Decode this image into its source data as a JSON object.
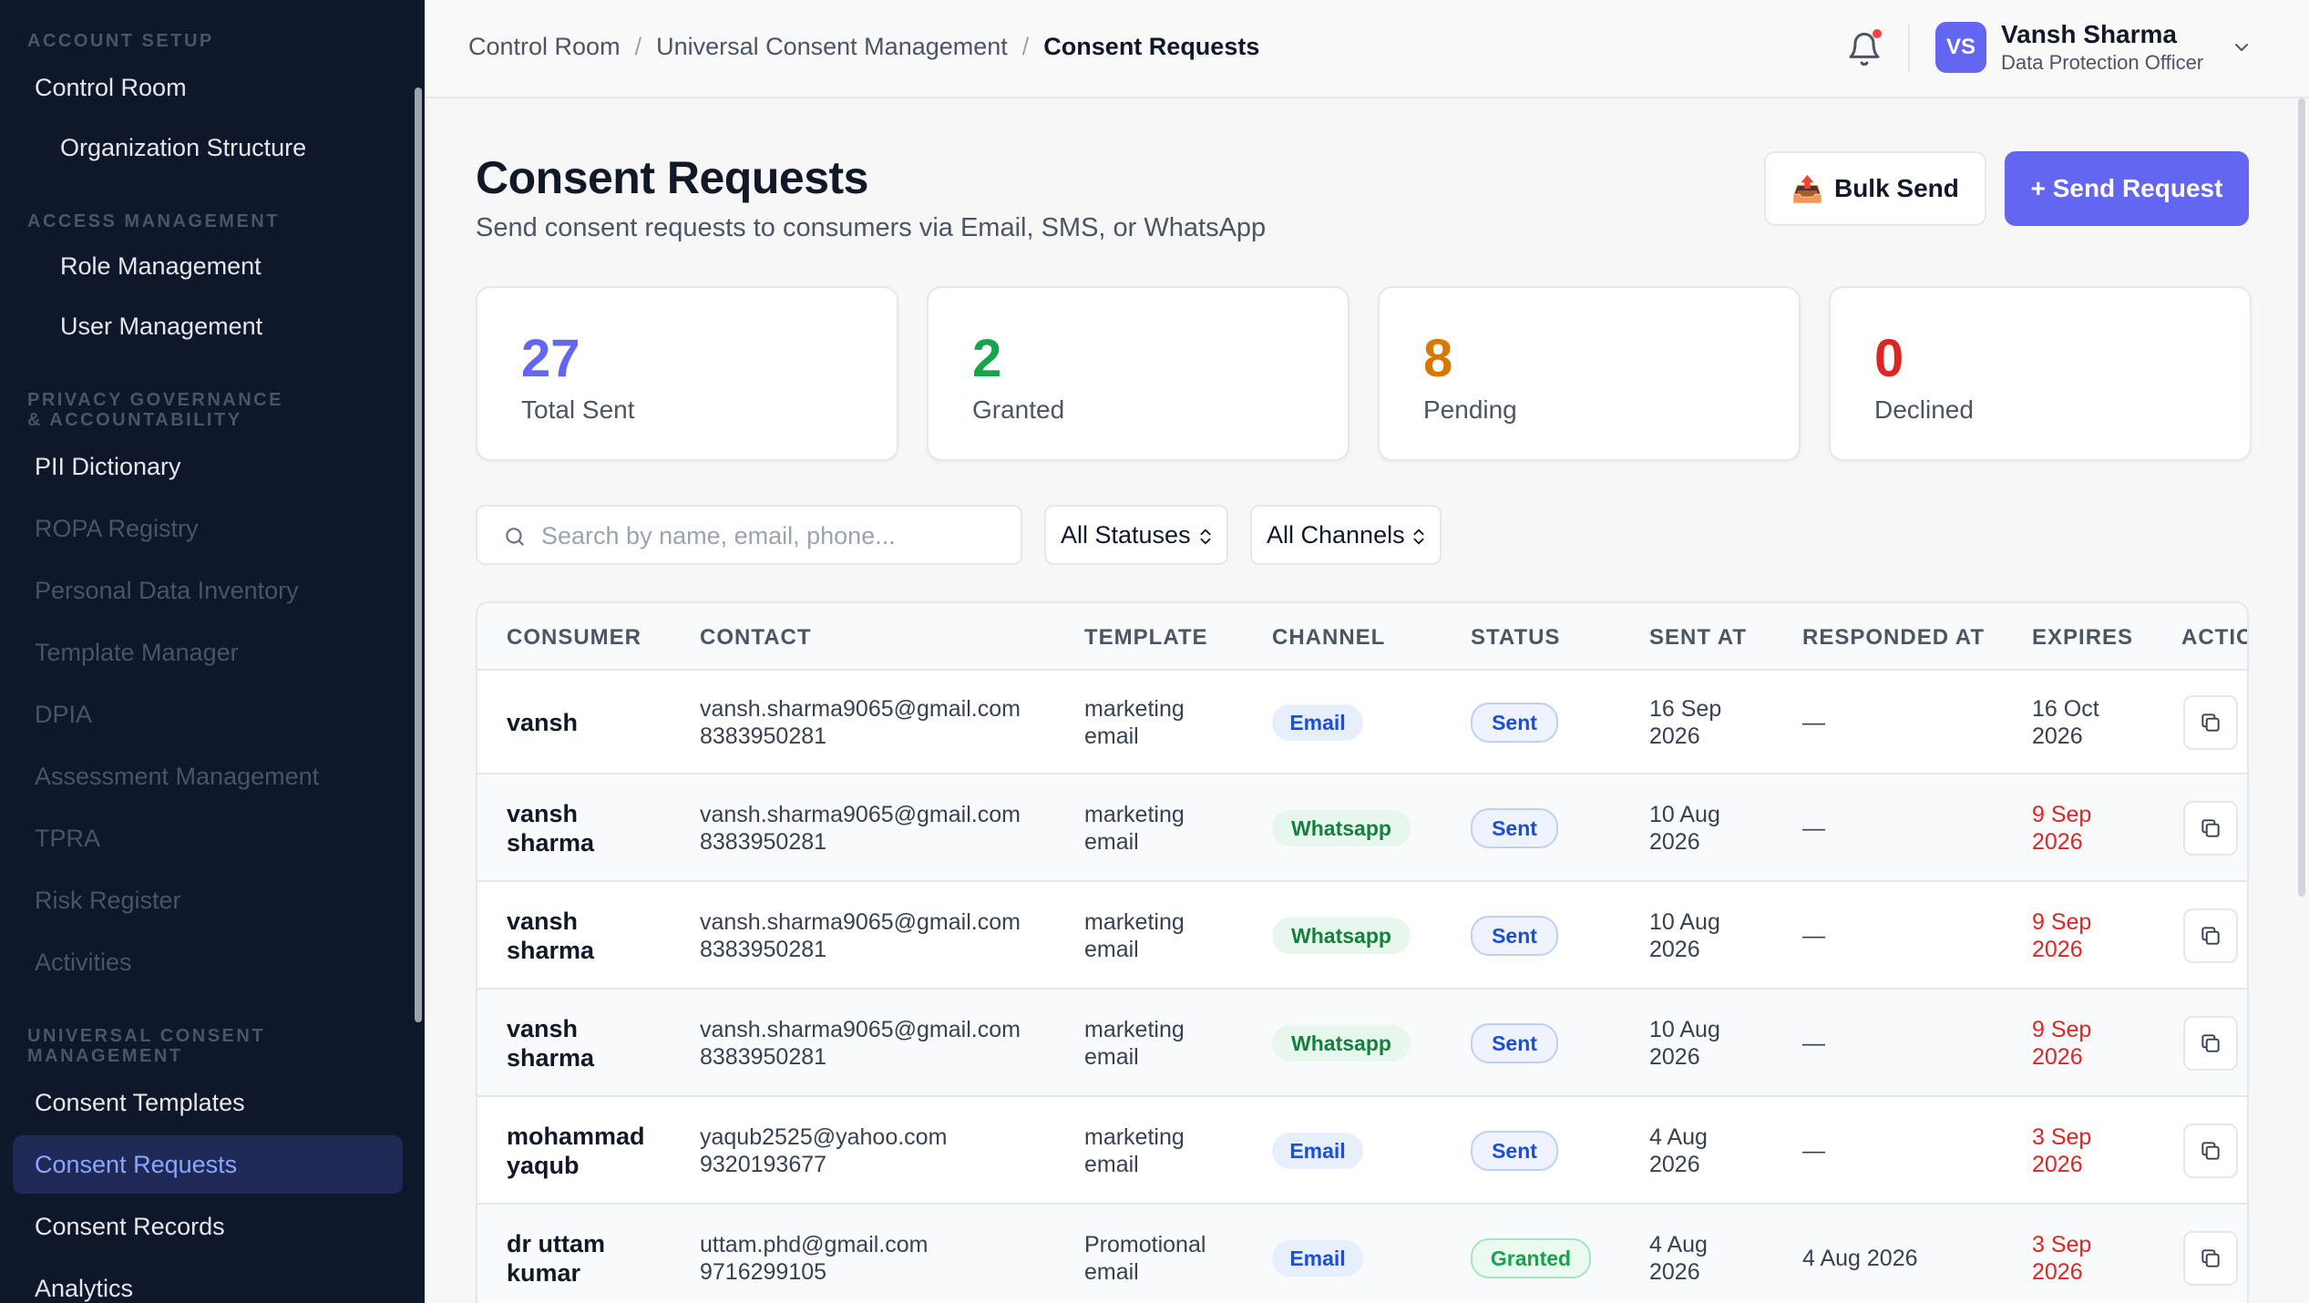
{
  "sidebar": {
    "sections": {
      "account_setup": "ACCOUNT SETUP",
      "access_management": "ACCESS MANAGEMENT",
      "privacy_governance": "PRIVACY GOVERNANCE & ACCOUNTABILITY",
      "universal_consent": "UNIVERSAL CONSENT MANAGEMENT"
    },
    "items": {
      "control_room": "Control Room",
      "organization_structure": "Organization Structure",
      "role_management": "Role Management",
      "user_management": "User Management",
      "pii_dictionary": "PII Dictionary",
      "ropa_registry": "ROPA Registry",
      "personal_data_inventory": "Personal Data Inventory",
      "template_manager": "Template Manager",
      "dpia": "DPIA",
      "assessment_management": "Assessment Management",
      "tpra": "TPRA",
      "risk_register": "Risk Register",
      "activities": "Activities",
      "consent_templates": "Consent Templates",
      "consent_requests": "Consent Requests",
      "consent_records": "Consent Records",
      "analytics": "Analytics"
    }
  },
  "header": {
    "breadcrumb": [
      "Control Room",
      "Universal Consent Management",
      "Consent Requests"
    ],
    "separator": "/",
    "user": {
      "initials": "VS",
      "name": "Vansh Sharma",
      "role": "Data Protection Officer"
    }
  },
  "page": {
    "title": "Consent Requests",
    "subtitle": "Send consent requests to consumers via Email, SMS, or WhatsApp",
    "bulk_send_icon": "📤",
    "bulk_send_label": "Bulk Send",
    "send_request_label": "+ Send Request"
  },
  "stats": {
    "total_sent": {
      "value": "27",
      "label": "Total Sent",
      "color": "#6366f1"
    },
    "granted": {
      "value": "2",
      "label": "Granted",
      "color": "#16a34a"
    },
    "pending": {
      "value": "8",
      "label": "Pending",
      "color": "#d97706"
    },
    "declined": {
      "value": "0",
      "label": "Declined",
      "color": "#dc2626"
    }
  },
  "filters": {
    "search_placeholder": "Search by name, email, phone...",
    "status": "All Statuses",
    "channel": "All Channels"
  },
  "table": {
    "columns": [
      "CONSUMER",
      "CONTACT",
      "TEMPLATE",
      "CHANNEL",
      "STATUS",
      "SENT AT",
      "RESPONDED AT",
      "EXPIRES",
      "ACTIO"
    ],
    "rows": [
      {
        "consumer": "vansh",
        "email": "vansh.sharma9065@gmail.com",
        "phone": "8383950281",
        "template": "marketing email",
        "channel": "Email",
        "status": "Sent",
        "sent_at": "16 Sep 2026",
        "responded_at": "—",
        "expires": "16 Oct 2026"
      },
      {
        "consumer": "vansh sharma",
        "email": "vansh.sharma9065@gmail.com",
        "phone": "8383950281",
        "template": "marketing email",
        "channel": "Whatsapp",
        "status": "Sent",
        "sent_at": "10 Aug 2026",
        "responded_at": "—",
        "expires": "9 Sep 2026"
      },
      {
        "consumer": "vansh sharma",
        "email": "vansh.sharma9065@gmail.com",
        "phone": "8383950281",
        "template": "marketing email",
        "channel": "Whatsapp",
        "status": "Sent",
        "sent_at": "10 Aug 2026",
        "responded_at": "—",
        "expires": "9 Sep 2026"
      },
      {
        "consumer": "vansh sharma",
        "email": "vansh.sharma9065@gmail.com",
        "phone": "8383950281",
        "template": "marketing email",
        "channel": "Whatsapp",
        "status": "Sent",
        "sent_at": "10 Aug 2026",
        "responded_at": "—",
        "expires": "9 Sep 2026"
      },
      {
        "consumer": "mohammad yaqub",
        "email": "yaqub2525@yahoo.com",
        "phone": "9320193677",
        "template": "marketing email",
        "channel": "Email",
        "status": "Sent",
        "sent_at": "4 Aug 2026",
        "responded_at": "—",
        "expires": "3 Sep 2026"
      },
      {
        "consumer": "dr uttam kumar",
        "email": "uttam.phd@gmail.com",
        "phone": "9716299105",
        "template": "Promotional email",
        "channel": "Email",
        "status": "Granted",
        "sent_at": "4 Aug 2026",
        "responded_at": "4 Aug 2026",
        "expires": "3 Sep 2026"
      }
    ]
  }
}
